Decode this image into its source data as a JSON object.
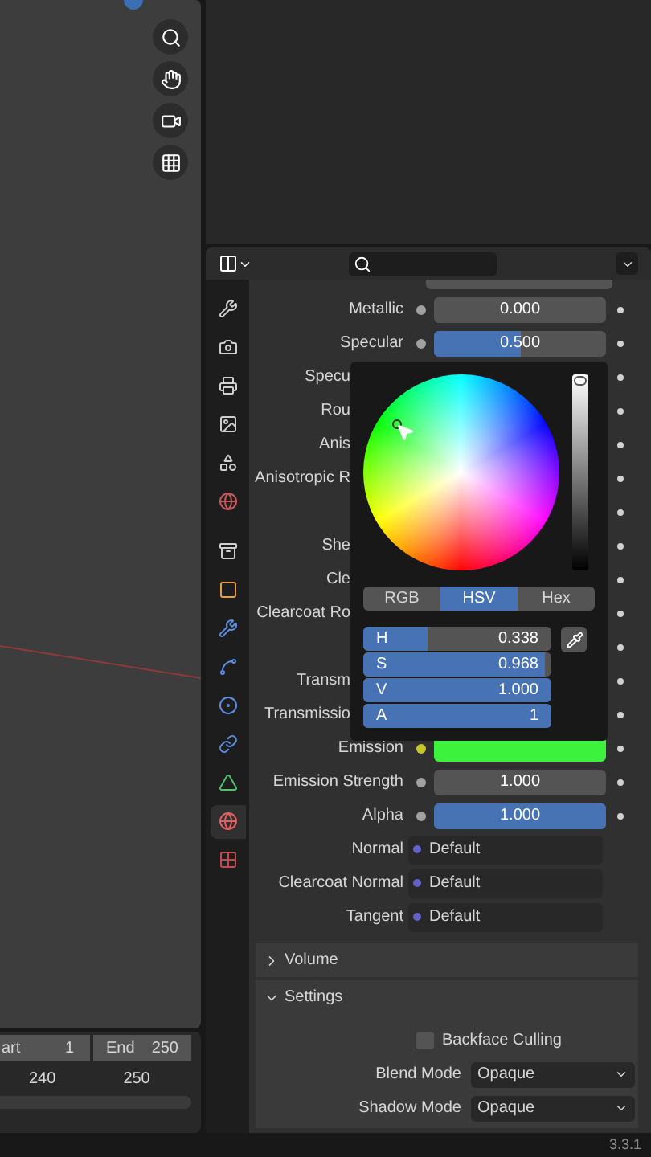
{
  "viewport": {
    "timeline": {
      "start_label": "art",
      "start_value": "1",
      "end_label": "End",
      "end_value": "250",
      "ticks": [
        "240",
        "250"
      ]
    }
  },
  "sidebar_tabs": [
    {
      "selected": false
    },
    {
      "selected": false
    },
    {
      "selected": false
    },
    {
      "selected": false
    },
    {
      "selected": false
    },
    {
      "selected": false
    },
    {
      "selected": false
    },
    {
      "selected": false
    },
    {
      "selected": false
    },
    {
      "selected": false
    },
    {
      "selected": false
    },
    {
      "selected": false
    },
    {
      "selected": false
    },
    {
      "selected": true
    },
    {
      "selected": false
    }
  ],
  "properties": {
    "rows": [
      {
        "label": "Metallic",
        "kind": "number",
        "value": "0.000",
        "socket": {
          "color": "#a1a1a1"
        }
      },
      {
        "label": "Specular",
        "kind": "number",
        "value": "0.500",
        "level": 0.5,
        "socket": {
          "color": "#a1a1a1"
        }
      },
      {
        "label": "Specu",
        "kind": "covered"
      },
      {
        "label": "Rou",
        "kind": "covered"
      },
      {
        "label": "Anis",
        "kind": "covered"
      },
      {
        "label": "Anisotropic R",
        "kind": "covered"
      },
      {
        "kind": "covered"
      },
      {
        "label": "She",
        "kind": "covered"
      },
      {
        "label": "Cle",
        "kind": "covered"
      },
      {
        "label": "Clearcoat Ro",
        "kind": "covered"
      },
      {
        "kind": "covered"
      },
      {
        "label": "Transm",
        "kind": "covered"
      },
      {
        "label": "Transmissio",
        "kind": "covered"
      },
      {
        "label": "Emission",
        "kind": "color",
        "swatch": {
          "color": "#3df23d"
        },
        "socket": {
          "color": "#c7c729"
        }
      },
      {
        "label": "Emission Strength",
        "kind": "number",
        "value": "1.000",
        "socket": {
          "color": "#a1a1a1"
        }
      },
      {
        "label": "Alpha",
        "kind": "number",
        "value": "1.000",
        "level": 1,
        "socket": {
          "color": "#a1a1a1"
        }
      },
      {
        "label": "Normal",
        "kind": "link",
        "value": "Default",
        "socket": {
          "color": "#6363c7"
        }
      },
      {
        "label": "Clearcoat Normal",
        "kind": "link",
        "value": "Default",
        "socket": {
          "color": "#6363c7"
        }
      },
      {
        "label": "Tangent",
        "kind": "link",
        "value": "Default",
        "socket": {
          "color": "#6363c7"
        }
      }
    ],
    "panels": [
      {
        "title": "Volume",
        "expanded": false
      },
      {
        "title": "Settings",
        "expanded": true
      }
    ],
    "settings": {
      "backface_culling": {
        "label": "Backface Culling",
        "checked": false
      },
      "selects": [
        {
          "label": "Blend Mode",
          "value": "Opaque"
        },
        {
          "label": "Shadow Mode",
          "value": "Opaque"
        }
      ]
    }
  },
  "color_picker": {
    "value_slider": {
      "level": 1
    },
    "tabs": [
      {
        "label": "RGB",
        "selected": false
      },
      {
        "label": "HSV",
        "selected": true
      },
      {
        "label": "Hex",
        "selected": false
      }
    ],
    "fields": [
      {
        "label": "H",
        "value": "0.338",
        "level": 0.338
      },
      {
        "label": "S",
        "value": "0.968",
        "level": 0.968
      },
      {
        "label": "V",
        "value": "1.000",
        "level": 1
      },
      {
        "label": "A",
        "value": "1",
        "level": 1
      }
    ]
  },
  "status_bar": {
    "version": "3.3.1"
  }
}
